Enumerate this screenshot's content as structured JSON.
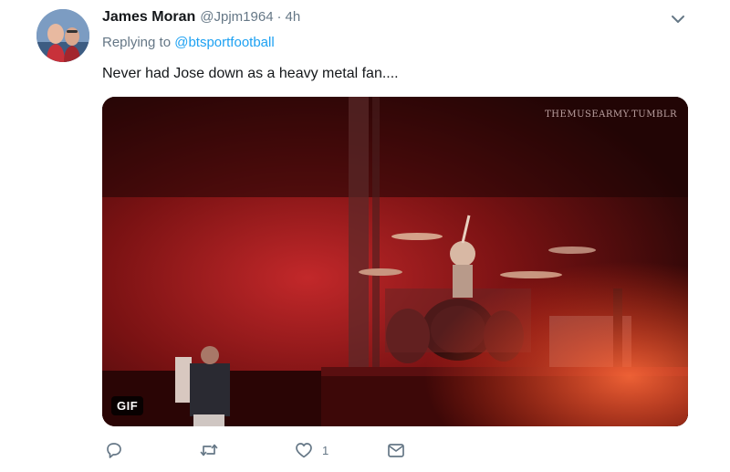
{
  "tweet": {
    "author_name": "James Moran",
    "author_handle": "@Jpjm1964",
    "separator": "·",
    "timestamp": "4h",
    "replying_prefix": "Replying to",
    "replying_to": "@btsportfootball",
    "text": "Never had Jose down as a heavy metal fan....",
    "media": {
      "watermark": "THEMUSEARMY.TUMBLR",
      "badge": "GIF"
    },
    "actions": {
      "reply_icon": "reply-icon",
      "retweet_icon": "retweet-icon",
      "like_icon": "heart-icon",
      "like_count": "1",
      "message_icon": "envelope-icon"
    }
  },
  "colors": {
    "accent": "#1da1f2",
    "text": "#14171a",
    "muted": "#657786"
  }
}
